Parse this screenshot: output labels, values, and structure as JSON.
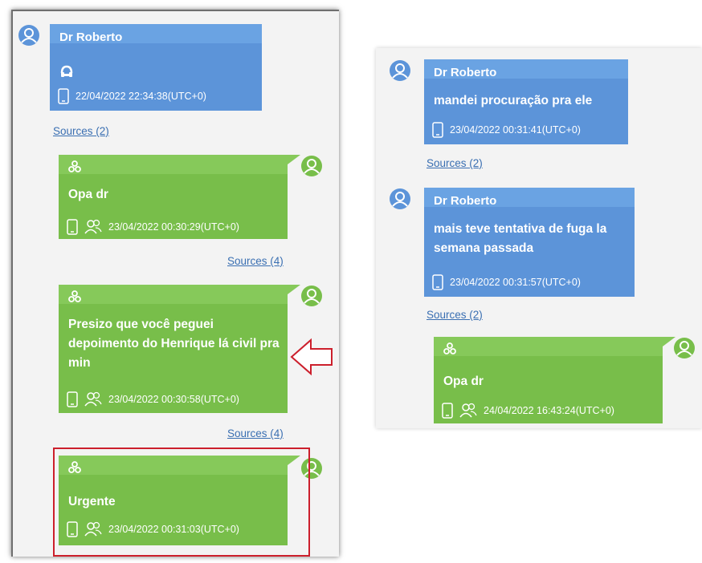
{
  "colors": {
    "incoming": "#5c94d9",
    "outgoing": "#78be4a",
    "link": "#3a6fb2",
    "highlight": "#cc1f2c"
  },
  "left_panel": {
    "messages": [
      {
        "direction": "incoming",
        "sender": "Dr Roberto",
        "content_icon": "audio-attachment-icon",
        "timestamp": "22/04/2022 22:34:38(UTC+0)",
        "sources": "Sources (2)"
      },
      {
        "direction": "outgoing",
        "text": "Opa dr",
        "timestamp": "23/04/2022 00:30:29(UTC+0)",
        "sources": "Sources (4)"
      },
      {
        "direction": "outgoing",
        "text": "Presizo que você peguei depoimento do Henrique lá civil pra min",
        "timestamp": "23/04/2022 00:30:58(UTC+0)",
        "sources": "Sources (4)",
        "annotation": "arrow-pointer"
      },
      {
        "direction": "outgoing",
        "text": "Urgente",
        "timestamp": "23/04/2022 00:31:03(UTC+0)",
        "annotation": "red-box"
      }
    ]
  },
  "right_panel": {
    "messages": [
      {
        "direction": "incoming",
        "sender": "Dr Roberto",
        "text": "mandei procuração pra ele",
        "timestamp": "23/04/2022 00:31:41(UTC+0)",
        "sources": "Sources (2)"
      },
      {
        "direction": "incoming",
        "sender": "Dr Roberto",
        "text": "mais teve tentativa de fuga la semana passada",
        "timestamp": "23/04/2022 00:31:57(UTC+0)",
        "sources": "Sources (2)"
      },
      {
        "direction": "outgoing",
        "text": "Opa dr",
        "timestamp": "24/04/2022 16:43:24(UTC+0)"
      }
    ]
  }
}
